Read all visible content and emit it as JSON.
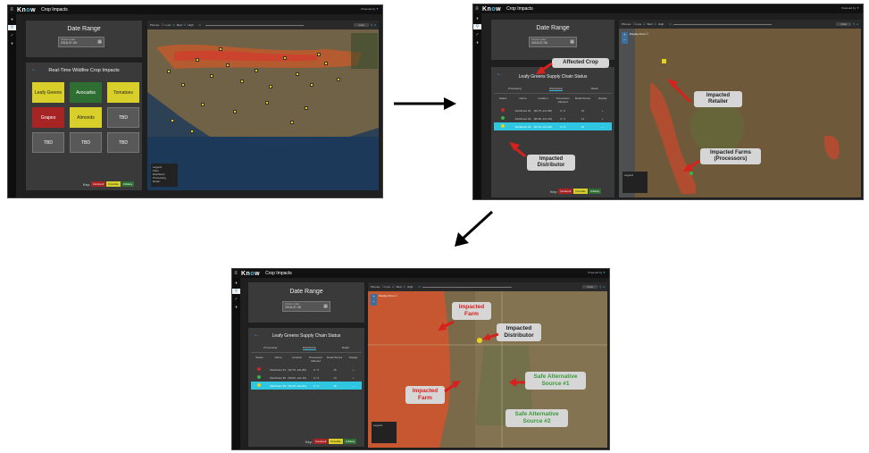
{
  "app": {
    "brand_pre": "Kn",
    "brand_mid": "o",
    "brand_post": "w",
    "title": "Crop Impacts",
    "powered": "Powered by"
  },
  "panel1": {
    "date_title": "Date Range",
    "date_label": "Choose a date",
    "date_value": "2018-07-09",
    "impacts_title": "Real-Time Wildfire Crop Impacts",
    "tiles": [
      {
        "label": "Leafy Greens",
        "color": "#d9cf2b"
      },
      {
        "label": "Avocados",
        "color": "#2f6e32"
      },
      {
        "label": "Tomatoes",
        "color": "#d9cf2b"
      },
      {
        "label": "Grapes",
        "color": "#a62424"
      },
      {
        "label": "Almonds",
        "color": "#d9cf2b"
      },
      {
        "label": "TBD",
        "color": "#585858"
      },
      {
        "label": "TBD",
        "color": "#585858"
      },
      {
        "label": "TBD",
        "color": "#585858"
      },
      {
        "label": "TBD",
        "color": "#585858"
      }
    ],
    "key_label": "Key:",
    "key_items": [
      {
        "label": "Imminent",
        "color": "#a62424"
      },
      {
        "label": "Possible",
        "color": "#d9cf2b"
      },
      {
        "label": "Unlikely",
        "color": "#2f6e32"
      }
    ],
    "map_bar": {
      "plumes": "Plumes:",
      "low": "Low",
      "med": "Med",
      "high": "High",
      "crop": "Crop"
    },
    "legend": {
      "title": "Legend",
      "items": [
        "Farm",
        "Distributor",
        "Processing",
        "Retail"
      ]
    }
  },
  "panel2": {
    "date_title": "Date Range",
    "date_value": "2018-07-06",
    "chain_title": "Leafy Greens Supply Chain Status",
    "groups": [
      "Processing",
      "Distribution",
      "Retail"
    ],
    "headers": [
      "Status",
      "Name",
      "Location",
      "Processors Affected",
      "Retail Stores",
      "Display"
    ],
    "rows": [
      {
        "name": "Distributor #1",
        "location": "[39.75,-121.85]",
        "affected": "0 / 3",
        "stores": "15",
        "display": "+",
        "dot": "#c72a2a",
        "highlight": false
      },
      {
        "name": "Distributor #2",
        "location": "[38.60,-121.49]",
        "affected": "0 / 3",
        "stores": "14",
        "display": "+",
        "dot": "#38b24a",
        "highlight": false
      },
      {
        "name": "Distributor #3",
        "location": "[39.15,-121.62]",
        "affected": "2 / 4",
        "stores": "16",
        "display": "—",
        "dot": "#e6d31f",
        "highlight": true
      }
    ],
    "display_fires": "Display Fires",
    "callouts": {
      "affected_crop": "Affected Crop",
      "impacted_distributor": "Impacted Distributor",
      "impacted_retailer": "Impacted Retailer",
      "impacted_farms": "Impacted Farms (Processors)"
    },
    "key_label": "Key:",
    "key_items": [
      {
        "label": "Imminent",
        "color": "#a62424"
      },
      {
        "label": "Possible",
        "color": "#d9cf2b"
      },
      {
        "label": "Unlikely",
        "color": "#2f6e32"
      }
    ]
  },
  "panel3": {
    "date_title": "Date Range",
    "date_value": "2018-07-06",
    "chain_title": "Leafy Greens Supply Chain Status",
    "display_fires": "Display Fires",
    "callouts": {
      "impacted_farm_top": "Impacted Farm",
      "impacted_distributor": "Impacted Distributor",
      "impacted_farm_bottom": "Impacted Farm",
      "safe_alt_1": "Safe Alternative Source #1",
      "safe_alt_2": "Safe Alternative Source #2"
    },
    "key_label": "Key:",
    "key_items": [
      {
        "label": "Imminent",
        "color": "#a62424"
      },
      {
        "label": "Possible",
        "color": "#d9cf2b"
      },
      {
        "label": "Unlikely",
        "color": "#2f6e32"
      }
    ]
  }
}
